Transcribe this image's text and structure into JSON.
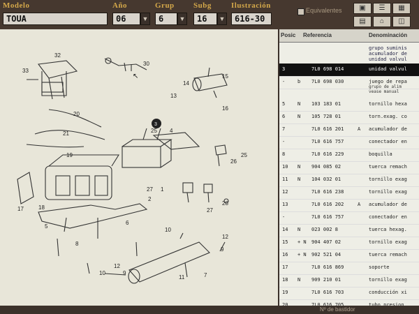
{
  "header": {
    "modelo_label": "Modelo",
    "modelo_value": "TOUA",
    "ano_label": "Año",
    "ano_value": "06",
    "grup_label": "Grup",
    "grup_value": "6",
    "subg_label": "Subg",
    "subg_value": "16",
    "ilustracion_label": "Ilustración",
    "ilustracion_value": "616-30",
    "equivalentes_label": "Equivalentes"
  },
  "table": {
    "headers": {
      "pos": "Posic",
      "ref": "Referencia",
      "den": "Denominación"
    },
    "intro_lines": [
      "grupo suminis",
      "acumulador de",
      "unidad valvul"
    ],
    "rows": [
      {
        "pos": "3",
        "mark": "",
        "ref": "7L0 698 014",
        "suffix": "",
        "den": "unidad valvul",
        "selected": true
      },
      {
        "pos": "-",
        "mark": "b",
        "ref": "7L0 698 030",
        "suffix": "",
        "den": "juego de repa",
        "selected": false
      },
      {
        "pos": "5",
        "mark": "N",
        "ref": "103 183 01",
        "suffix": "",
        "den": "tornillo hexa",
        "selected": false
      },
      {
        "pos": "6",
        "mark": "N",
        "ref": "105 728 01",
        "suffix": "",
        "den": "torn.exag. co",
        "selected": false
      },
      {
        "pos": "7",
        "mark": "",
        "ref": "7L0 616 201",
        "suffix": "A",
        "den": "acumulador de",
        "selected": false
      },
      {
        "pos": "-",
        "mark": "",
        "ref": "7L0 616 757",
        "suffix": "",
        "den": "conectador en",
        "selected": false
      },
      {
        "pos": "8",
        "mark": "",
        "ref": "7L0 616 229",
        "suffix": "",
        "den": "boquilla",
        "selected": false
      },
      {
        "pos": "10",
        "mark": "N",
        "ref": "904 085 02",
        "suffix": "",
        "den": "tuerca remach",
        "selected": false
      },
      {
        "pos": "11",
        "mark": "N",
        "ref": "104 032 01",
        "suffix": "",
        "den": "tornillo exag",
        "selected": false
      },
      {
        "pos": "12",
        "mark": "",
        "ref": "7L0 616 238",
        "suffix": "",
        "den": "tornillo exag",
        "selected": false
      },
      {
        "pos": "13",
        "mark": "",
        "ref": "7L0 616 202",
        "suffix": "A",
        "den": "acumulador de",
        "selected": false
      },
      {
        "pos": "-",
        "mark": "",
        "ref": "7L0 616 757",
        "suffix": "",
        "den": "conectador en",
        "selected": false
      },
      {
        "pos": "14",
        "mark": "N",
        "ref": "023 002 8",
        "suffix": "",
        "den": "tuerca hexag.",
        "selected": false
      },
      {
        "pos": "15",
        "mark": "+ N",
        "ref": "904 407 02",
        "suffix": "",
        "den": "tornillo exag",
        "selected": false
      },
      {
        "pos": "16",
        "mark": "+ N",
        "ref": "902 521 04",
        "suffix": "",
        "den": "tuerca remach",
        "selected": false
      },
      {
        "pos": "17",
        "mark": "",
        "ref": "7L0 616 869",
        "suffix": "",
        "den": "soporte",
        "selected": false
      },
      {
        "pos": "18",
        "mark": "N",
        "ref": "909 210 01",
        "suffix": "",
        "den": "tornillo exag",
        "selected": false
      },
      {
        "pos": "19",
        "mark": "",
        "ref": "7L0 616 703",
        "suffix": "",
        "den": "conducción xi",
        "selected": false
      },
      {
        "pos": "20",
        "mark": "",
        "ref": "7L0 616 705",
        "suffix": "",
        "den": "tubo presion",
        "selected": false
      }
    ]
  },
  "extra_lines": [
    "grupo de alim",
    "vease manual"
  ],
  "status": {
    "text": "Nº de bastidor"
  },
  "diagram": {
    "callouts": [
      "32",
      "33",
      "30",
      "15",
      "14",
      "13",
      "16",
      "20",
      "21",
      "19",
      "3",
      "25",
      "4",
      "25",
      "26",
      "17",
      "18",
      "27",
      "1",
      "2",
      "5",
      "6",
      "8",
      "9",
      "10",
      "12",
      "11",
      "7",
      "12",
      "28",
      "27",
      "23",
      "22",
      "24"
    ]
  }
}
